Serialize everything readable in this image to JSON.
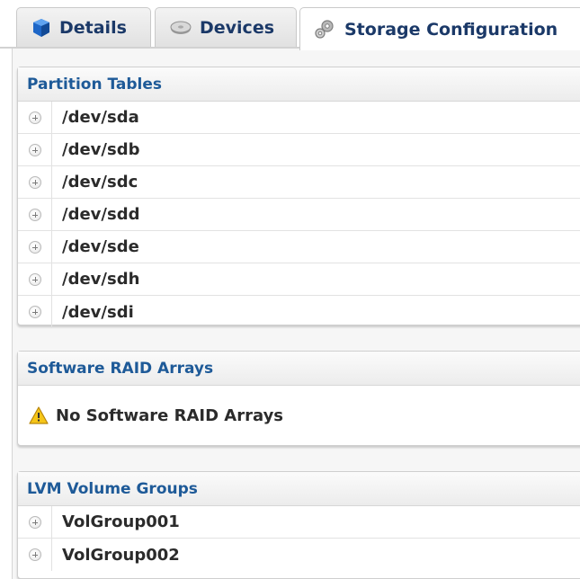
{
  "tabs": {
    "details": {
      "label": "Details",
      "icon": "cube-icon"
    },
    "devices": {
      "label": "Devices",
      "icon": "disk-icon"
    },
    "storage": {
      "label": "Storage Configuration",
      "icon": "gears-icon",
      "active": true
    }
  },
  "partition_tables": {
    "title": "Partition Tables",
    "items": [
      {
        "label": "/dev/sda"
      },
      {
        "label": "/dev/sdb"
      },
      {
        "label": "/dev/sdc"
      },
      {
        "label": "/dev/sdd"
      },
      {
        "label": "/dev/sde"
      },
      {
        "label": "/dev/sdh"
      },
      {
        "label": "/dev/sdi"
      }
    ]
  },
  "raid": {
    "title": "Software RAID Arrays",
    "message": "No Software RAID Arrays"
  },
  "lvm": {
    "title": "LVM Volume Groups",
    "items": [
      {
        "label": "VolGroup001"
      },
      {
        "label": "VolGroup002"
      }
    ]
  },
  "colors": {
    "header_text": "#1e5a98",
    "tab_text": "#1b3968",
    "warning": "#f5c518"
  }
}
